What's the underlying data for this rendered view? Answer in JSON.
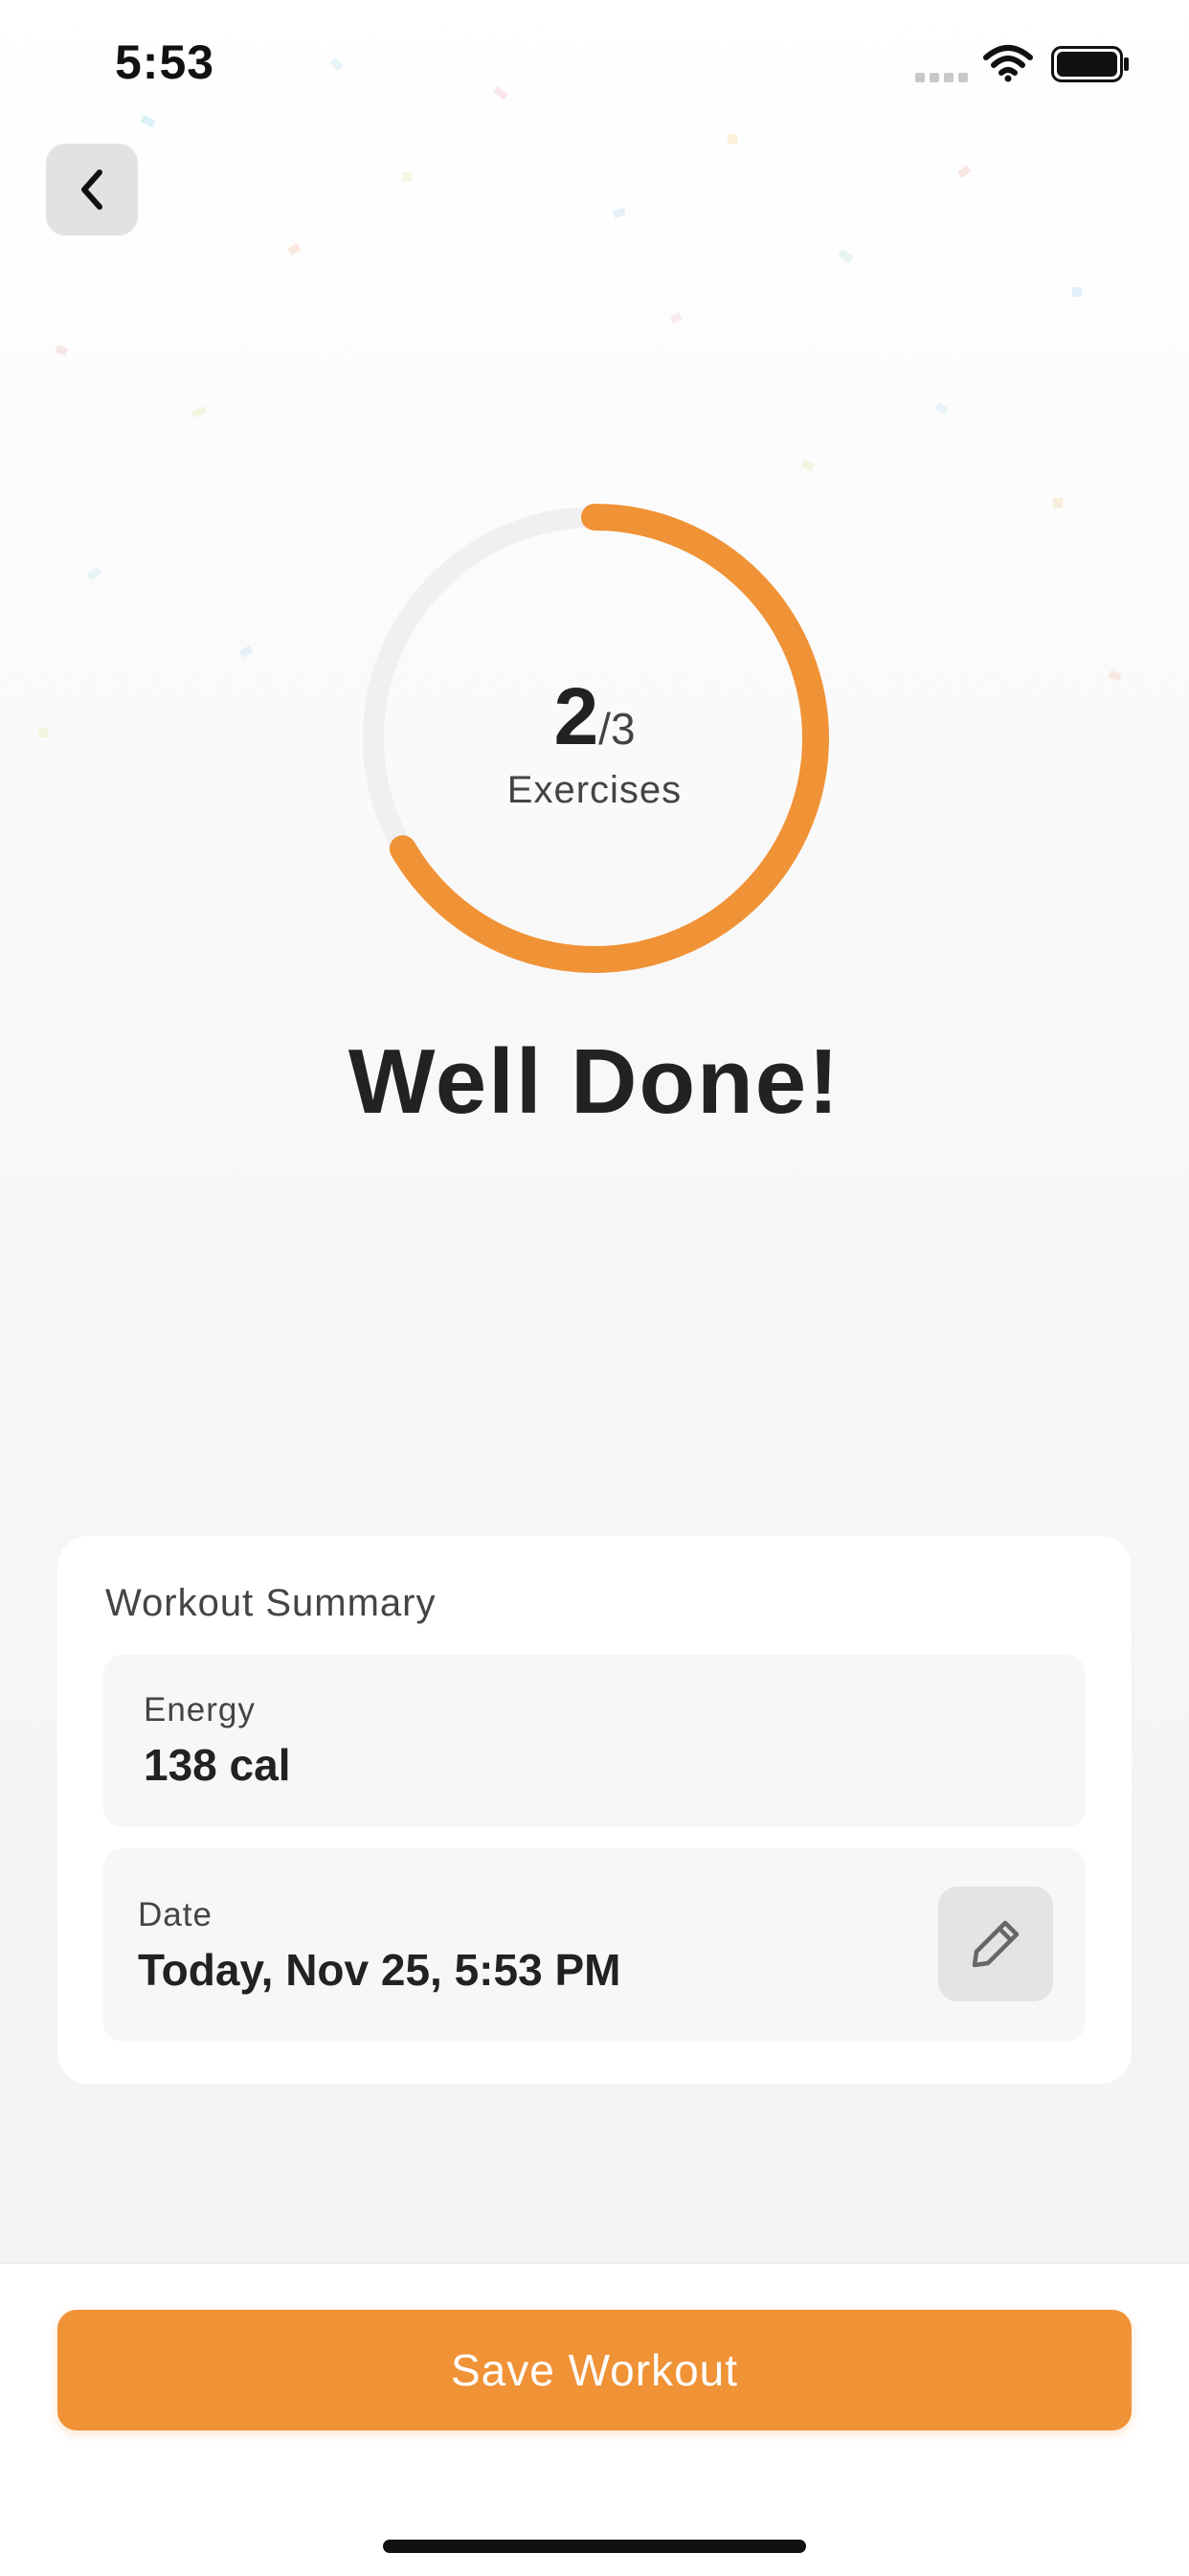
{
  "status_bar": {
    "time": "5:53"
  },
  "icons": {
    "back": "chevron-left-icon",
    "edit": "pencil-icon",
    "wifi": "wifi-icon",
    "battery": "battery-icon",
    "signal": "signal-icon"
  },
  "progress": {
    "completed": "2",
    "total": "/3",
    "label": "Exercises",
    "fraction": 0.6667
  },
  "headline": "Well Done!",
  "summary": {
    "title": "Workout Summary",
    "energy": {
      "label": "Energy",
      "value": "138 cal"
    },
    "date": {
      "label": "Date",
      "value": "Today, Nov 25, 5:53 PM"
    }
  },
  "actions": {
    "save_label": "Save Workout"
  },
  "colors": {
    "accent": "#f09236",
    "ring_track": "#f0f0f0",
    "text_primary": "#222222"
  }
}
